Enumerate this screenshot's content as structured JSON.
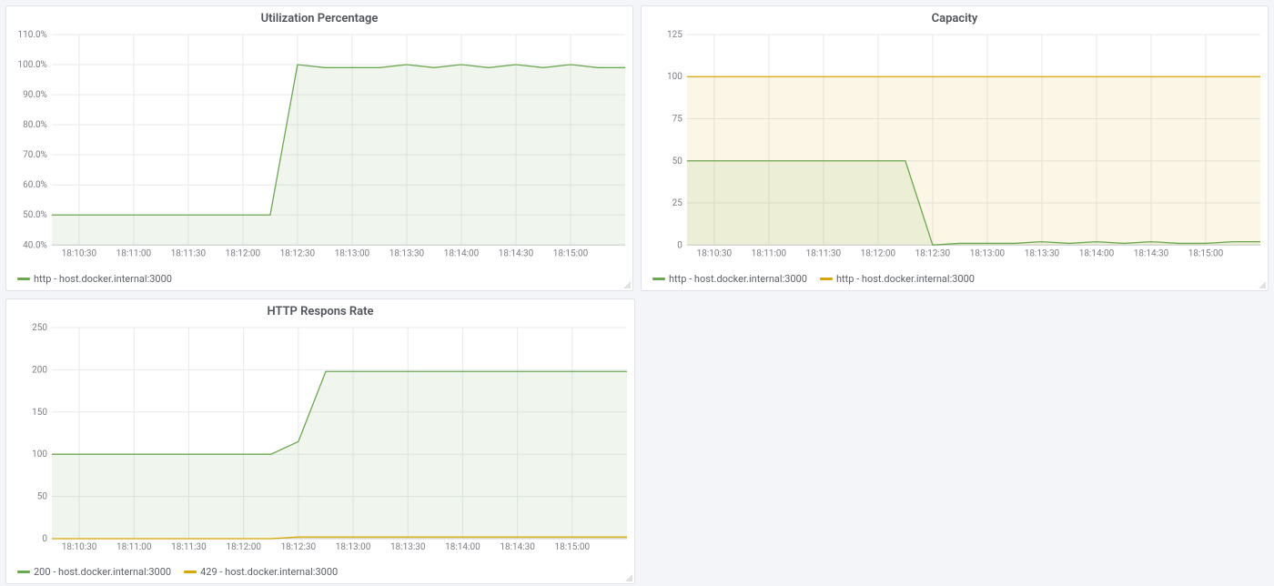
{
  "x_categories_labels": [
    "18:10:30",
    "18:11:00",
    "18:11:30",
    "18:12:00",
    "18:12:30",
    "18:13:00",
    "18:13:30",
    "18:14:00",
    "18:14:30",
    "18:15:00"
  ],
  "x_categories_sec": [
    0,
    30,
    60,
    90,
    120,
    150,
    180,
    210,
    240,
    270
  ],
  "panels": {
    "util": {
      "title": "Utilization Percentage",
      "legend": [
        {
          "color": "green",
          "label": "http - host.docker.internal:3000"
        }
      ]
    },
    "cap": {
      "title": "Capacity",
      "legend": [
        {
          "color": "green",
          "label": "http - host.docker.internal:3000"
        },
        {
          "color": "yellow",
          "label": "http - host.docker.internal:3000"
        }
      ]
    },
    "resp": {
      "title": "HTTP Respons Rate",
      "legend": [
        {
          "color": "green",
          "label": "200 - host.docker.internal:3000"
        },
        {
          "color": "yellow",
          "label": "429 - host.docker.internal:3000"
        }
      ]
    }
  },
  "chart_data": [
    {
      "id": "util",
      "type": "area",
      "title": "Utilization Percentage",
      "xlabel": "",
      "ylabel": "",
      "x_tick_labels": [
        "18:10:30",
        "18:11:00",
        "18:11:30",
        "18:12:00",
        "18:12:30",
        "18:13:00",
        "18:13:30",
        "18:14:00",
        "18:14:30",
        "18:15:00"
      ],
      "y_tick_labels": [
        "40.0%",
        "50.0%",
        "60.0%",
        "70.0%",
        "80.0%",
        "90.0%",
        "100.0%",
        "110.0%"
      ],
      "ylim": [
        40,
        110
      ],
      "xlim_sec": [
        -15,
        300
      ],
      "series": [
        {
          "name": "http - host.docker.internal:3000",
          "color": "green",
          "x_sec": [
            -15,
            0,
            30,
            60,
            90,
            105,
            120,
            135,
            150,
            165,
            180,
            195,
            210,
            225,
            240,
            255,
            270,
            285,
            300
          ],
          "y": [
            50,
            50,
            50,
            50,
            50,
            50,
            100,
            99,
            99,
            99,
            100,
            99,
            100,
            99,
            100,
            99,
            100,
            99,
            99
          ]
        }
      ]
    },
    {
      "id": "cap",
      "type": "area",
      "title": "Capacity",
      "xlabel": "",
      "ylabel": "",
      "x_tick_labels": [
        "18:10:30",
        "18:11:00",
        "18:11:30",
        "18:12:00",
        "18:12:30",
        "18:13:00",
        "18:13:30",
        "18:14:00",
        "18:14:30",
        "18:15:00"
      ],
      "y_tick_labels": [
        "0",
        "25",
        "50",
        "75",
        "100",
        "125"
      ],
      "ylim": [
        0,
        125
      ],
      "xlim_sec": [
        -15,
        300
      ],
      "series": [
        {
          "name": "http - host.docker.internal:3000",
          "color": "yellow",
          "x_sec": [
            -15,
            300
          ],
          "y": [
            100,
            100
          ]
        },
        {
          "name": "http - host.docker.internal:3000",
          "color": "green",
          "x_sec": [
            -15,
            0,
            30,
            60,
            90,
            105,
            120,
            135,
            150,
            165,
            180,
            195,
            210,
            225,
            240,
            255,
            270,
            285,
            300
          ],
          "y": [
            50,
            50,
            50,
            50,
            50,
            50,
            0,
            1,
            1,
            1,
            2,
            1,
            2,
            1,
            2,
            1,
            1,
            2,
            2
          ]
        }
      ]
    },
    {
      "id": "resp",
      "type": "area",
      "title": "HTTP Respons Rate",
      "xlabel": "",
      "ylabel": "",
      "x_tick_labels": [
        "18:10:30",
        "18:11:00",
        "18:11:30",
        "18:12:00",
        "18:12:30",
        "18:13:00",
        "18:13:30",
        "18:14:00",
        "18:14:30",
        "18:15:00"
      ],
      "y_tick_labels": [
        "0",
        "50",
        "100",
        "150",
        "200",
        "250"
      ],
      "ylim": [
        0,
        250
      ],
      "xlim_sec": [
        -15,
        300
      ],
      "series": [
        {
          "name": "200 - host.docker.internal:3000",
          "color": "green",
          "x_sec": [
            -15,
            0,
            30,
            60,
            90,
            105,
            120,
            135,
            150,
            180,
            210,
            240,
            270,
            300
          ],
          "y": [
            100,
            100,
            100,
            100,
            100,
            100,
            115,
            198,
            198,
            198,
            198,
            198,
            198,
            198
          ]
        },
        {
          "name": "429 - host.docker.internal:3000",
          "color": "yellow",
          "x_sec": [
            -15,
            90,
            105,
            120,
            300
          ],
          "y": [
            0,
            0,
            0,
            2,
            2
          ]
        }
      ]
    }
  ]
}
